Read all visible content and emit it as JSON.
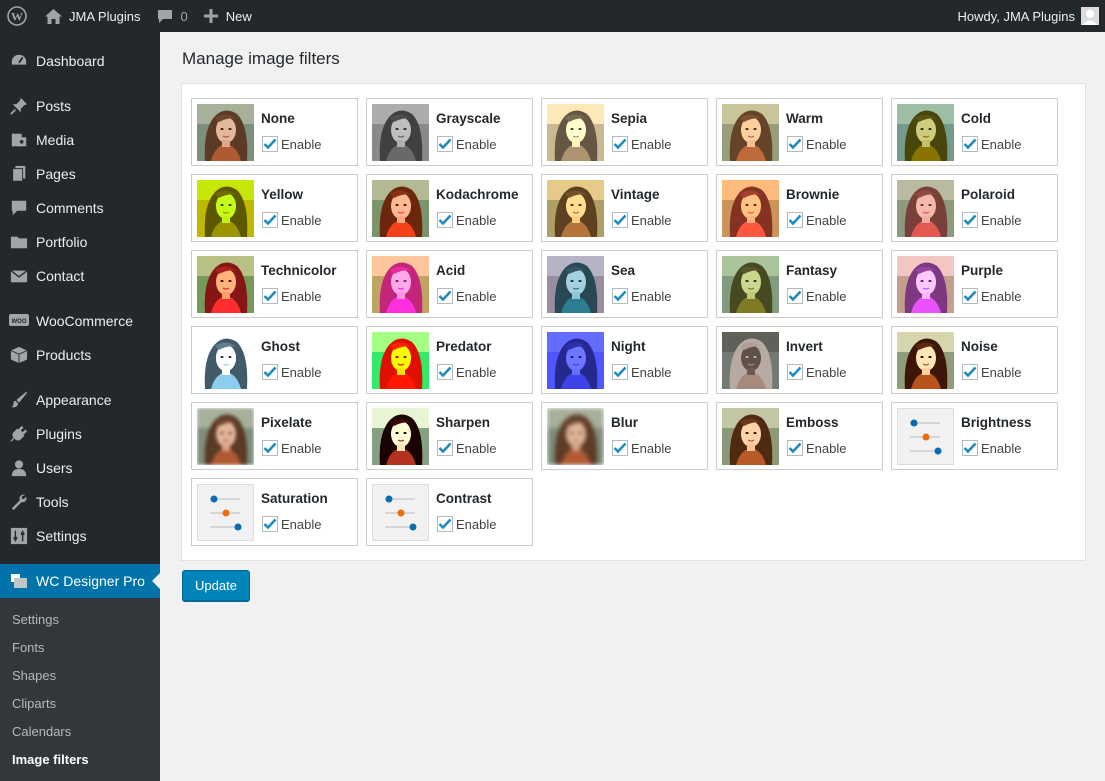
{
  "adminbar": {
    "site_name": "JMA Plugins",
    "comments_count": "0",
    "new_label": "New",
    "howdy": "Howdy, JMA Plugins"
  },
  "sidebar": {
    "items": [
      {
        "label": "Dashboard",
        "icon": "dashboard-icon"
      },
      {
        "label": "Posts",
        "icon": "pin-icon"
      },
      {
        "label": "Media",
        "icon": "media-icon"
      },
      {
        "label": "Pages",
        "icon": "pages-icon"
      },
      {
        "label": "Comments",
        "icon": "comment-icon"
      },
      {
        "label": "Portfolio",
        "icon": "folder-icon"
      },
      {
        "label": "Contact",
        "icon": "envelope-icon"
      },
      {
        "label": "WooCommerce",
        "icon": "woo-icon"
      },
      {
        "label": "Products",
        "icon": "box-icon"
      },
      {
        "label": "Appearance",
        "icon": "brush-icon"
      },
      {
        "label": "Plugins",
        "icon": "plug-icon"
      },
      {
        "label": "Users",
        "icon": "user-icon"
      },
      {
        "label": "Tools",
        "icon": "wrench-icon"
      },
      {
        "label": "Settings",
        "icon": "sliders-icon"
      },
      {
        "label": "WC Designer Pro",
        "icon": "layers-icon"
      }
    ],
    "submenu": [
      "Settings",
      "Fonts",
      "Shapes",
      "Cliparts",
      "Calendars",
      "Image filters"
    ]
  },
  "page": {
    "title": "Manage image filters",
    "update_label": "Update"
  },
  "filter_enable_label": "Enable",
  "filters": [
    {
      "name": "None",
      "enabled": true
    },
    {
      "name": "Grayscale",
      "enabled": true
    },
    {
      "name": "Sepia",
      "enabled": true
    },
    {
      "name": "Warm",
      "enabled": true
    },
    {
      "name": "Cold",
      "enabled": true
    },
    {
      "name": "Yellow",
      "enabled": true
    },
    {
      "name": "Kodachrome",
      "enabled": true
    },
    {
      "name": "Vintage",
      "enabled": true
    },
    {
      "name": "Brownie",
      "enabled": true
    },
    {
      "name": "Polaroid",
      "enabled": true
    },
    {
      "name": "Technicolor",
      "enabled": true
    },
    {
      "name": "Acid",
      "enabled": true
    },
    {
      "name": "Sea",
      "enabled": true
    },
    {
      "name": "Fantasy",
      "enabled": true
    },
    {
      "name": "Purple",
      "enabled": true
    },
    {
      "name": "Ghost",
      "enabled": true
    },
    {
      "name": "Predator",
      "enabled": true
    },
    {
      "name": "Night",
      "enabled": true
    },
    {
      "name": "Invert",
      "enabled": true
    },
    {
      "name": "Noise",
      "enabled": true
    },
    {
      "name": "Pixelate",
      "enabled": true
    },
    {
      "name": "Sharpen",
      "enabled": true
    },
    {
      "name": "Blur",
      "enabled": true
    },
    {
      "name": "Emboss",
      "enabled": true
    },
    {
      "name": "Brightness",
      "enabled": true
    },
    {
      "name": "Saturation",
      "enabled": true
    },
    {
      "name": "Contrast",
      "enabled": true
    }
  ],
  "colors": {
    "adminbar_bg": "#23282d",
    "accent": "#0073aa",
    "button": "#0085ba"
  }
}
